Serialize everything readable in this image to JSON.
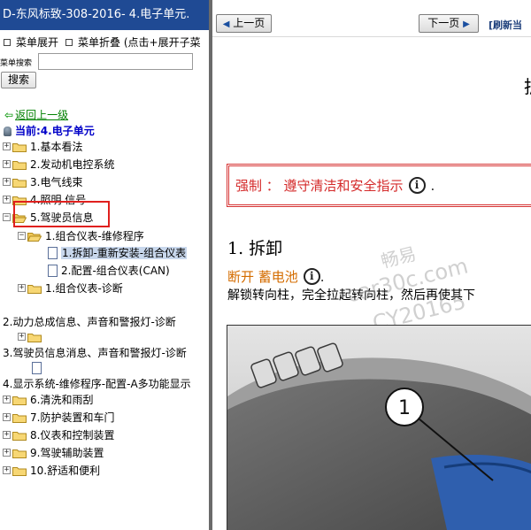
{
  "left": {
    "title": "D-东风标致-308-2016- 4.电子单元.",
    "menu_expand": "菜单展开",
    "menu_collapse": "菜单折叠 (点击+展开子菜",
    "search_label": "菜单搜索",
    "search_value": "",
    "search_button": "搜索",
    "back_link": "返回上一级",
    "current": "当前:4.电子单元",
    "tree": [
      {
        "label": "1.基本看法"
      },
      {
        "label": "2.发动机电控系统"
      },
      {
        "label": "3.电气线束"
      },
      {
        "label": "4.照明 信号"
      },
      {
        "label": "5.驾驶员信息"
      },
      {
        "label": "1.组合仪表-维修程序"
      },
      {
        "label": "1.拆卸-重新安装-组合仪表"
      },
      {
        "label": "2.配置-组合仪表(CAN)"
      },
      {
        "label": "1.组合仪表-诊断"
      },
      {
        "label": "2.动力总成信息、声音和警报灯-诊断"
      },
      {
        "label": ""
      },
      {
        "label": "3.驾驶员信息消息、声音和警报灯-诊断"
      },
      {
        "label": ""
      },
      {
        "label": "4.显示系统-维修程序-配置-A多功能显示"
      },
      {
        "label": "6.清洗和雨刮"
      },
      {
        "label": "7.防护装置和车门"
      },
      {
        "label": "8.仪表和控制装置"
      },
      {
        "label": "9.驾驶辅助装置"
      },
      {
        "label": "10.舒适和便利"
      }
    ]
  },
  "right": {
    "prev_button": "上一页",
    "next_button": "下一页",
    "refresh": "[刷新当",
    "top_char": "拆",
    "mandatory": {
      "label": "强制 ： 遵守清洁和安全指示",
      "icon": "i",
      "dot": "."
    },
    "section_heading": "1.  拆卸",
    "disconnect": {
      "label": "断开  蓄电池",
      "icon": "i",
      "dot": "."
    },
    "body_text": "解锁转向柱，完全拉起转向柱，然后再使其下",
    "watermark": {
      "line1": "畅易",
      "line2": "car30c.com",
      "line3": "CY20165"
    },
    "figure_callout": "1"
  },
  "colors": {
    "title_bar": "#1f4a94",
    "highlight_box": "#e0201e",
    "current_text": "#0000c8",
    "back_link": "#008000",
    "mandatory_red": "#d42a2a",
    "disconnect_orange": "#d46c00"
  },
  "icons": {
    "back": "arrow-left-icon",
    "folder": "folder-icon",
    "document": "document-icon",
    "expand": "plus-box-icon",
    "collapse": "minus-box-icon",
    "info": "info-circle-icon",
    "location": "pin-icon"
  }
}
